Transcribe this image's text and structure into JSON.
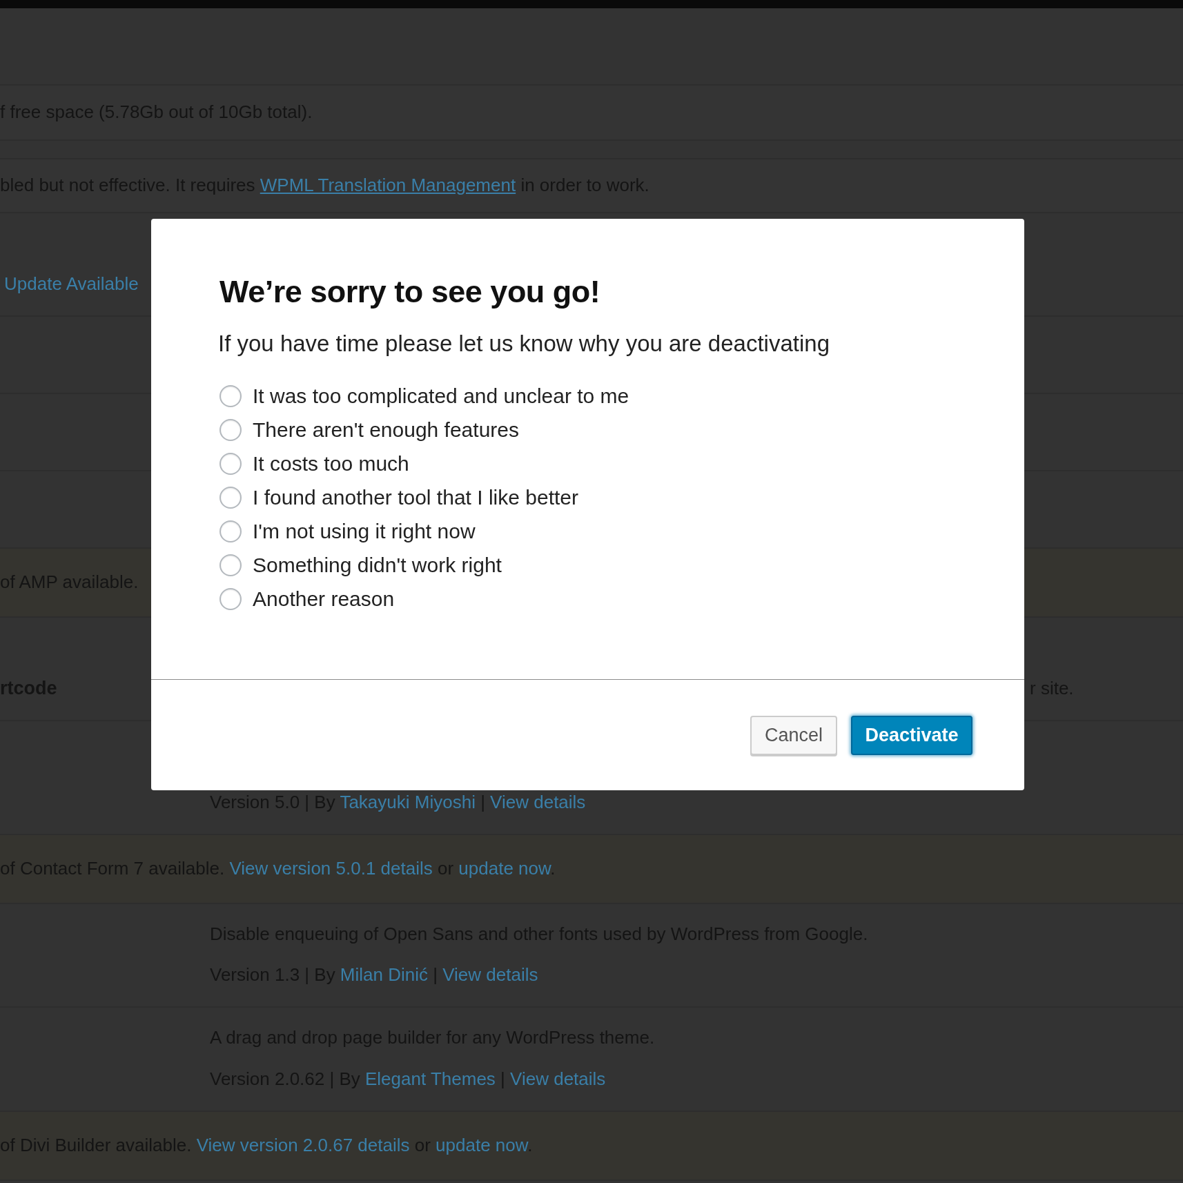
{
  "page": {
    "rows": [
      {
        "kind": "blank"
      },
      {
        "kind": "notice",
        "lines": [
          {
            "kind": "text",
            "segments": [
              {
                "kind": "text",
                "text": "f free space (5.78Gb out of 10Gb total)."
              }
            ]
          }
        ]
      },
      {
        "kind": "notice",
        "lines": [
          {
            "kind": "text",
            "segments": [
              {
                "kind": "text",
                "text": "bled but not effective. It requires "
              },
              {
                "kind": "underlined-link",
                "text": "WPML Translation Management"
              },
              {
                "kind": "text",
                "text": " in order to work."
              }
            ]
          }
        ]
      },
      {
        "kind": "plugin",
        "left": [
          {
            "kind": "text",
            "segments": [
              {
                "kind": "link",
                "text": "Update Available"
              }
            ]
          }
        ]
      },
      {
        "kind": "blank"
      },
      {
        "kind": "blank"
      },
      {
        "kind": "blank"
      },
      {
        "kind": "update",
        "lines": [
          {
            "kind": "text",
            "segments": [
              {
                "kind": "text",
                "text": "of AMP available."
              }
            ]
          }
        ]
      },
      {
        "kind": "plugin",
        "left": [
          {
            "kind": "name",
            "segments": [
              {
                "kind": "text",
                "text": "rtcode"
              }
            ]
          }
        ],
        "right": [
          {
            "kind": "trailing",
            "segments": [
              {
                "kind": "text",
                "text": "r site."
              }
            ]
          }
        ]
      },
      {
        "kind": "plugin",
        "right": [
          {
            "kind": "meta",
            "segments": [
              {
                "kind": "text",
                "text": "Version 5.0 | By "
              },
              {
                "kind": "link",
                "text": "Takayuki Miyoshi"
              },
              {
                "kind": "text",
                "text": " | "
              },
              {
                "kind": "link",
                "text": "View details"
              }
            ]
          }
        ]
      },
      {
        "kind": "update",
        "lines": [
          {
            "kind": "text",
            "segments": [
              {
                "kind": "text",
                "text": "of Contact Form 7 available. "
              },
              {
                "kind": "link",
                "text": "View version 5.0.1 details"
              },
              {
                "kind": "text",
                "text": " or "
              },
              {
                "kind": "link",
                "text": "update now"
              },
              {
                "kind": "text",
                "text": "."
              }
            ]
          }
        ]
      },
      {
        "kind": "plugin",
        "right": [
          {
            "kind": "text",
            "segments": [
              {
                "kind": "text",
                "text": "Disable enqueuing of Open Sans and other fonts used by WordPress from Google."
              }
            ]
          },
          {
            "kind": "meta",
            "segments": [
              {
                "kind": "text",
                "text": "Version 1.3 | By "
              },
              {
                "kind": "link",
                "text": "Milan Dinić"
              },
              {
                "kind": "text",
                "text": " | "
              },
              {
                "kind": "link",
                "text": "View details"
              }
            ]
          }
        ]
      },
      {
        "kind": "plugin",
        "right": [
          {
            "kind": "text",
            "segments": [
              {
                "kind": "text",
                "text": "A drag and drop page builder for any WordPress theme."
              }
            ]
          },
          {
            "kind": "meta",
            "segments": [
              {
                "kind": "text",
                "text": "Version 2.0.62 | By "
              },
              {
                "kind": "link",
                "text": "Elegant Themes"
              },
              {
                "kind": "text",
                "text": " | "
              },
              {
                "kind": "link",
                "text": "View details"
              }
            ]
          }
        ]
      },
      {
        "kind": "update",
        "lines": [
          {
            "kind": "text",
            "segments": [
              {
                "kind": "text",
                "text": "of Divi Builder available. "
              },
              {
                "kind": "link",
                "text": "View version 2.0.67 details"
              },
              {
                "kind": "text",
                "text": " or "
              },
              {
                "kind": "link",
                "text": "update now"
              },
              {
                "kind": "text",
                "text": "."
              }
            ]
          }
        ]
      }
    ]
  },
  "modal": {
    "title": "We’re sorry to see you go!",
    "subtitle": "If you have time please let us know why you are deactivating",
    "reasons": [
      {
        "label": "It was too complicated and unclear to me",
        "selected": false
      },
      {
        "label": "There aren't enough features",
        "selected": false
      },
      {
        "label": "It costs too much",
        "selected": false
      },
      {
        "label": "I found another tool that I like better",
        "selected": false
      },
      {
        "label": "I'm not using it right now",
        "selected": false
      },
      {
        "label": "Something didn't work right",
        "selected": false
      },
      {
        "label": "Another reason",
        "selected": false
      }
    ],
    "buttons": [
      {
        "kind": "secondary",
        "label": "Cancel"
      },
      {
        "kind": "primary",
        "label": "Deactivate"
      }
    ]
  }
}
